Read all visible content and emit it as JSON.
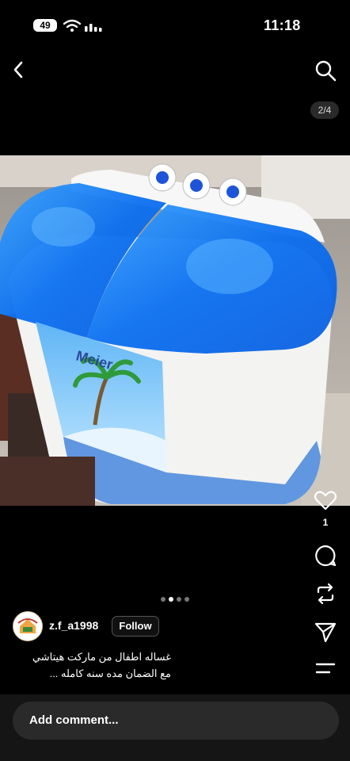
{
  "status_bar": {
    "battery": "49",
    "time": "11:18"
  },
  "nav": {
    "back_icon": "chevron-left-icon",
    "search_icon": "search-icon",
    "counter": "2/4"
  },
  "photo": {
    "brand_text": "Meier"
  },
  "actions": {
    "like_count": "1"
  },
  "carousel": {
    "total": 4,
    "active": 2
  },
  "post": {
    "username": "z.f_a1998",
    "follow_label": "Follow",
    "caption_line1": "غساله اطفال من ماركت هيتاشي",
    "caption_line2": "مع الضمان مده سنه كامله ..."
  },
  "comment": {
    "placeholder": "Add comment..."
  }
}
